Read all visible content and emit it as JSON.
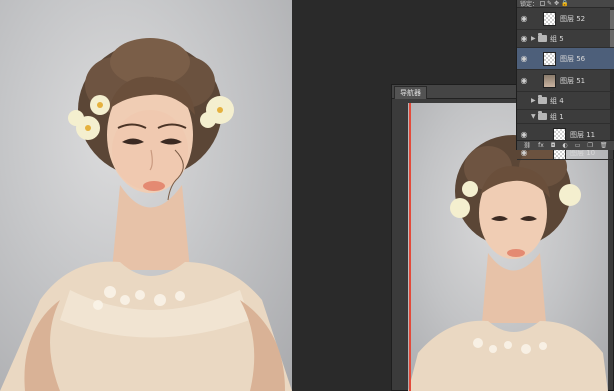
{
  "navigator": {
    "tab_label": "导航器"
  },
  "layers_panel": {
    "toolbar_text": "锁定：",
    "opacity_text": "填充：",
    "rows": [
      {
        "name": "图层 52",
        "visible": true,
        "type": "layer",
        "indent": false
      },
      {
        "name": "组 5",
        "visible": true,
        "type": "group",
        "indent": false
      },
      {
        "name": "图层 56",
        "visible": true,
        "type": "layer",
        "indent": false,
        "selected": true
      },
      {
        "name": "图层 51",
        "visible": true,
        "type": "photo",
        "indent": false
      },
      {
        "name": "组 4",
        "visible": false,
        "type": "group",
        "indent": false
      },
      {
        "name": "组 1",
        "visible": false,
        "type": "group-open",
        "indent": false
      },
      {
        "name": "图层 11",
        "visible": true,
        "type": "layer",
        "indent": true
      },
      {
        "name": "图层 10",
        "visible": true,
        "type": "layer",
        "indent": true
      }
    ],
    "footer_icons": [
      "link-icon",
      "fx-icon",
      "mask-icon",
      "adjustment-icon",
      "folder-icon",
      "new-layer-icon",
      "trash-icon"
    ]
  },
  "colors": {
    "panel": "#3c3c3c",
    "selected": "#4d5f7a",
    "navigator_view": "#e34a3a"
  }
}
